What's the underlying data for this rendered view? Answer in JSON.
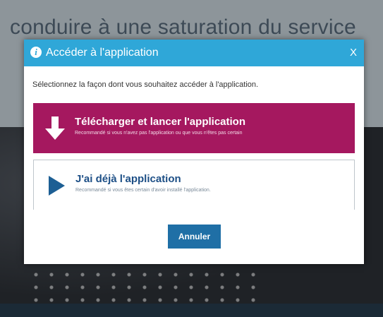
{
  "background": {
    "headline": "conduire à une saturation du service"
  },
  "dialog": {
    "title": "Accéder à l'application",
    "close_label": "X",
    "info_icon_glyph": "i",
    "instructions": "Sélectionnez la façon dont vous souhaitez accéder à l'application.",
    "options": [
      {
        "icon": "download-arrow-icon",
        "title": "Télécharger et lancer l'application",
        "subtitle": "Recommandé si vous n'avez pas l'application ou que vous n'êtes pas certain"
      },
      {
        "icon": "play-triangle-icon",
        "title": "J'ai déjà l'application",
        "subtitle": "Recommandé si vous êtes certain d'avoir installé l'application."
      }
    ],
    "cancel_label": "Annuler"
  },
  "colors": {
    "header": "#2fa7d8",
    "download_option": "#a5185f",
    "option_text": "#1d4f86",
    "cancel_button": "#1f6fa6"
  }
}
